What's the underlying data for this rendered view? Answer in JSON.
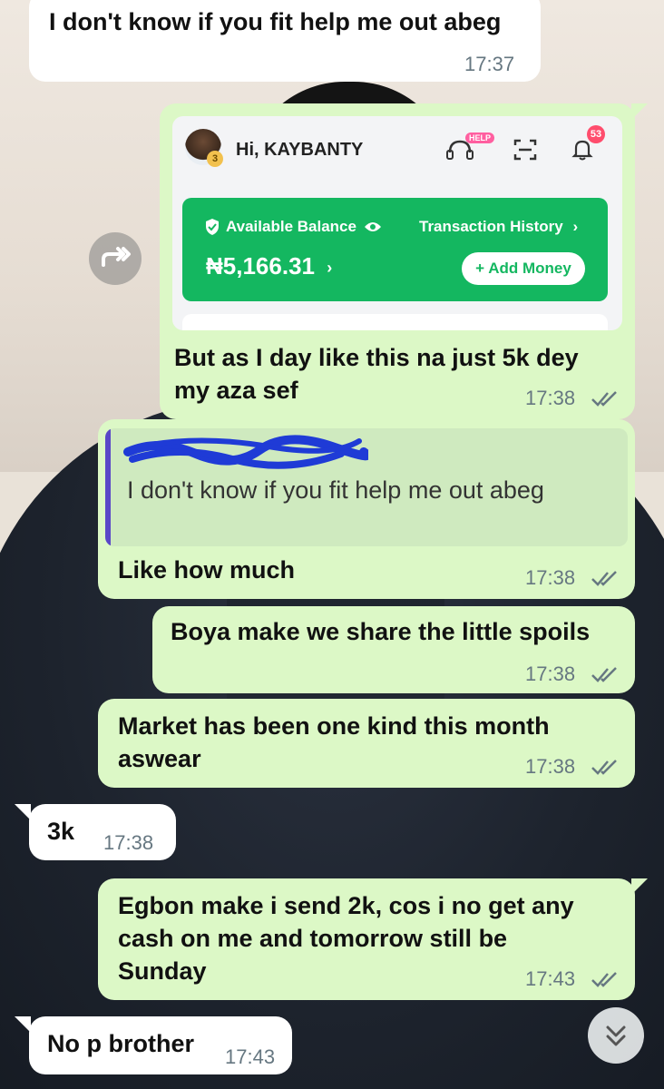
{
  "messages": [
    {
      "id": "m1",
      "direction": "incoming",
      "text": "I don't know if you fit help me out abeg",
      "time": "17:37"
    },
    {
      "id": "m2",
      "direction": "outgoing",
      "text": "But as I day like this na just 5k dey my aza sef",
      "time": "17:38",
      "status": "read"
    },
    {
      "id": "m3",
      "direction": "outgoing",
      "quoted": "I don't know if you fit help me out abeg",
      "text": "Like how much",
      "time": "17:38",
      "status": "read"
    },
    {
      "id": "m4",
      "direction": "outgoing",
      "text": "Boya make we share the little spoils",
      "time": "17:38",
      "status": "read"
    },
    {
      "id": "m5",
      "direction": "outgoing",
      "text": "Market has been one kind this month aswear",
      "time": "17:38",
      "status": "read"
    },
    {
      "id": "m6",
      "direction": "incoming",
      "text": "3k",
      "time": "17:38"
    },
    {
      "id": "m7",
      "direction": "outgoing",
      "text": "Egbon make i send 2k, cos i no get any cash on me and tomorrow still be Sunday",
      "time": "17:43",
      "status": "read"
    },
    {
      "id": "m8",
      "direction": "incoming",
      "text": "No p brother",
      "time": "17:43"
    }
  ],
  "screenshot": {
    "greeting": "Hi, KAYBANTY",
    "avatar_level": "3",
    "help_badge": "HELP",
    "notification_count": "53",
    "balance_label": "Available Balance",
    "history_label": "Transaction History",
    "history_chevron": "›",
    "amount": "₦5,166.31",
    "amount_chevron": "›",
    "add_money": "+ Add Money",
    "accent_color": "#14b760"
  },
  "icons": {
    "forward": "forward-icon",
    "scroll_down": "double-chevron-down-icon",
    "read_receipt": "double-check-icon"
  }
}
